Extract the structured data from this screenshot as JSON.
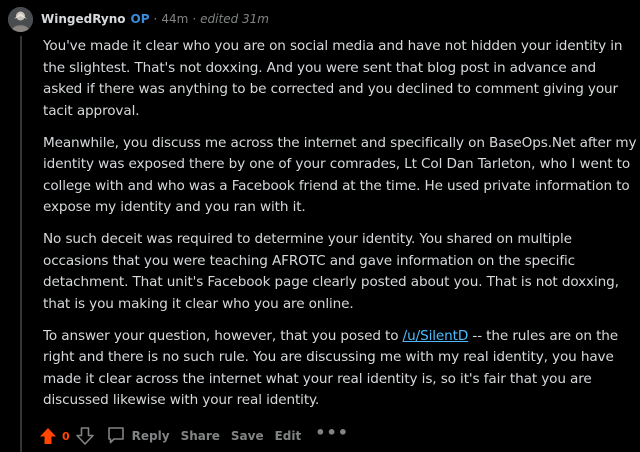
{
  "comment": {
    "author": "WingedRyno",
    "op_badge": "OP",
    "separator": "·",
    "age": "44m",
    "edited": "edited 31m",
    "paragraphs": [
      "You've made it clear who you are on social media and have not hidden your identity in the slightest. That's not doxxing. And you were sent that blog post in advance and asked if there was anything to be corrected and you declined to comment giving your tacit approval.",
      "Meanwhile, you discuss me across the internet and specifically on BaseOps.Net after my identity was exposed there by one of your comrades, Lt Col Dan Tarleton, who I went to college with and who was a Facebook friend at the time. He used private information to expose my identity and you ran with it.",
      "No such deceit was required to determine your identity. You shared on multiple occasions that you were teaching AFROTC and gave information on the specific detachment. That unit's Facebook page clearly posted about you. That is not doxxing, that is you making it clear who you are online."
    ],
    "last_paragraph": {
      "before_link": "To answer your question, however, that you posed to ",
      "link": "/u/SilentD",
      "after_link": " -- the rules are on the right and there is no such rule. You are discussing me with my real identity, you have made it clear across the internet what your real identity is, so it's fair that you are discussed likewise with your real identity."
    }
  },
  "actions": {
    "score": "0",
    "reply": "Reply",
    "share": "Share",
    "save": "Save",
    "edit": "Edit",
    "more": "•••"
  },
  "icons": {
    "upvote": "upvote-arrow-icon",
    "downvote": "downvote-arrow-icon",
    "reply": "comment-bubble-icon",
    "more": "more-dots-icon"
  },
  "colors": {
    "background": "#000000",
    "text": "#d7dadc",
    "muted": "#818384",
    "op": "#3b8bd9",
    "upvote": "#ff4500",
    "link": "#4fbcff"
  }
}
